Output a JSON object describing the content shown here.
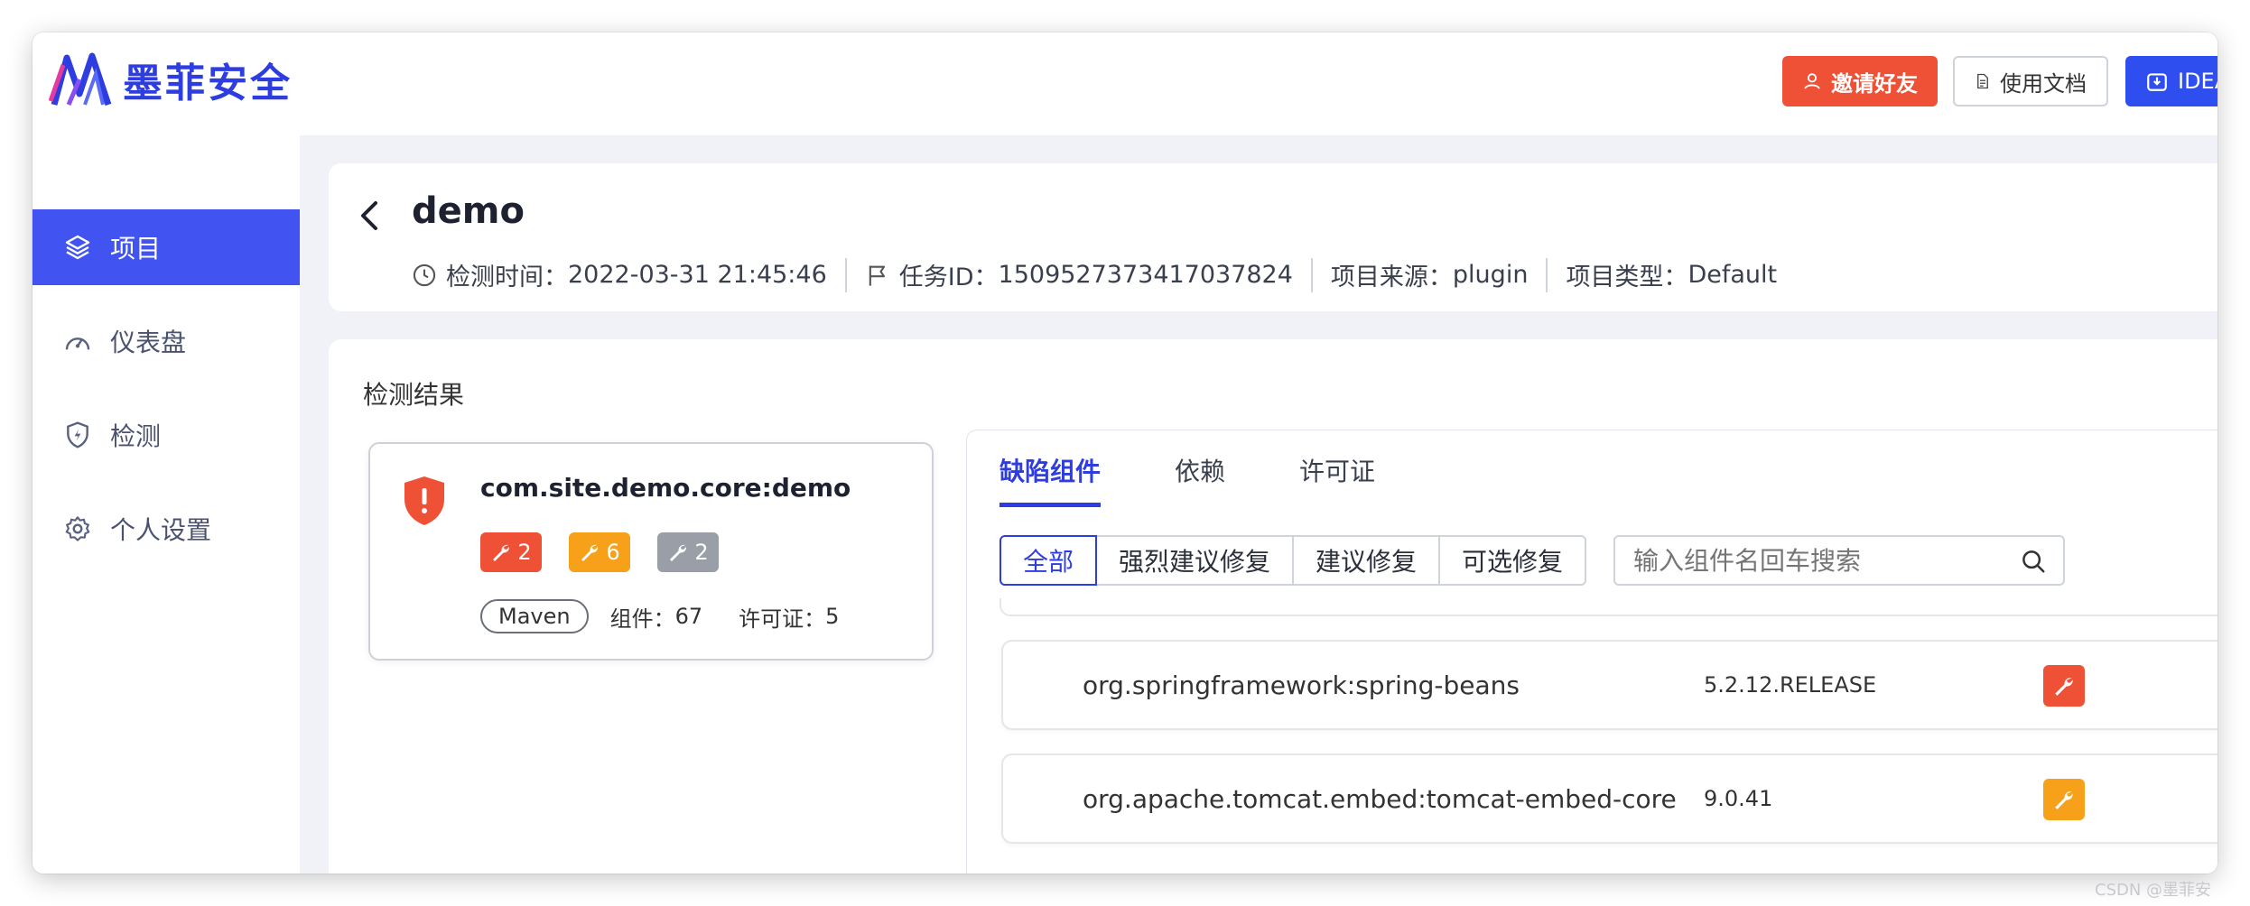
{
  "app": {
    "name": "墨菲安全",
    "accent": "#2d3de0",
    "danger": "#ef5136",
    "warning": "#f7a11a"
  },
  "header": {
    "invite_label": "邀请好友",
    "docs_label": "使用文档",
    "idea_label": "IDEA"
  },
  "sidebar": {
    "items": [
      {
        "label": "项目",
        "icon": "layers-icon",
        "active": true
      },
      {
        "label": "仪表盘",
        "icon": "gauge-icon"
      },
      {
        "label": "检测",
        "icon": "shield-bolt-icon"
      },
      {
        "label": "个人设置",
        "icon": "gear-icon"
      }
    ]
  },
  "project": {
    "title": "demo",
    "time_label": "检测时间：",
    "time_value": "2022-03-31 21:45:46",
    "task_label": "任务ID：",
    "task_value": "1509527373417037824",
    "source_label": "项目来源：",
    "source_value": "plugin",
    "type_label": "项目类型：",
    "type_value": "Default"
  },
  "results": {
    "title": "检测结果",
    "component": {
      "name": "com.site.demo.core:demo",
      "badges": [
        {
          "count": "2",
          "color": "#ef5136"
        },
        {
          "count": "6",
          "color": "#f7a11a"
        },
        {
          "count": "2",
          "color": "#9a9ea6"
        }
      ],
      "package_type": "Maven",
      "components_label": "组件：",
      "components_value": "67",
      "license_label": "许可证：",
      "license_value": "5"
    },
    "tabs": [
      "缺陷组件",
      "依赖",
      "许可证"
    ],
    "filters": [
      "全部",
      "强烈建议修复",
      "建议修复",
      "可选修复"
    ],
    "search_placeholder": "输入组件名回车搜索",
    "rows": [
      {
        "name": "org.springframework:spring-beans",
        "version": "5.2.12.RELEASE",
        "severity_color": "#ef5136"
      },
      {
        "name": "org.apache.tomcat.embed:tomcat-embed-core",
        "version": "9.0.41",
        "severity_color": "#f7a11a"
      }
    ]
  },
  "watermark": "CSDN @墨菲安"
}
